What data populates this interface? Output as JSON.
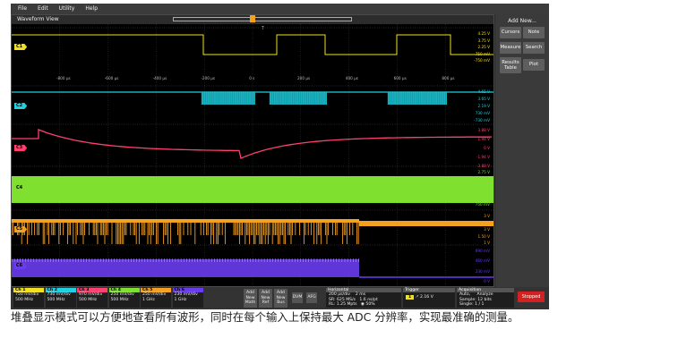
{
  "menu": [
    "File",
    "Edit",
    "Utility",
    "Help"
  ],
  "view_title": "Waveform View",
  "time_zero_marker": "T",
  "time_ticks": [
    "-800 µs",
    "-600 µs",
    "-400 µs",
    "-200 µs",
    "0 s",
    "200 µs",
    "400 µs",
    "600 µs",
    "800 µs"
  ],
  "channels": [
    {
      "label": "C1",
      "color": "#f0e020",
      "scale": [
        "4.25 V",
        "3.75 V",
        "2.25 V",
        "750 mV",
        "-750 mV"
      ]
    },
    {
      "label": "C2",
      "color": "#20d0e0",
      "scale": [
        "4.65 V",
        "3.65 V",
        "2.19 V",
        "730 mV",
        "-730 mV"
      ]
    },
    {
      "label": "C3",
      "color": "#ff4070",
      "scale": [
        "3.88 V",
        "1.94 V",
        "0 V",
        "-1.94 V",
        "-3.88 V"
      ]
    },
    {
      "label": "C4",
      "color": "#80e030",
      "scale": [
        "2.75 V",
        "2.25 V",
        "1.75 V",
        "1.25 V",
        "750 mV"
      ]
    },
    {
      "label": "C5",
      "color": "#f4a020",
      "scale": [
        "3 V",
        "450 V",
        "3 V",
        "1.50 V",
        "1 V"
      ]
    },
    {
      "label": "C6",
      "color": "#6a3cf0",
      "scale": [
        "690 mV",
        "460 mV",
        "230 mV",
        "0 V"
      ]
    }
  ],
  "right_panel": {
    "title": "Add New...",
    "buttons": [
      "Cursors",
      "Note",
      "Measure",
      "Search",
      "Results Table",
      "Plot"
    ]
  },
  "channel_badges": [
    {
      "name": "Ch 1",
      "color": "#f0e020",
      "vdiv": "750 mV/div",
      "bw": "500 MHz"
    },
    {
      "name": "Ch 2",
      "color": "#20d0e0",
      "vdiv": "730 mV/div",
      "bw": "500 MHz"
    },
    {
      "name": "Ch 3",
      "color": "#ff4070",
      "vdiv": "970 mV/div",
      "bw": "500 MHz"
    },
    {
      "name": "Ch 4",
      "color": "#80e030",
      "vdiv": "250 mV/div",
      "bw": "500 MHz"
    },
    {
      "name": "Ch 5",
      "color": "#f4a020",
      "vdiv": "250 mV/div",
      "bw": "1 GHz"
    },
    {
      "name": "Ch 6",
      "color": "#6a3cf0",
      "vdiv": "230 mV/div",
      "bw": "1 GHz"
    }
  ],
  "add_buttons": [
    {
      "line1": "Add",
      "line2": "New",
      "line3": "Math"
    },
    {
      "line1": "Add",
      "line2": "New",
      "line3": "Ref"
    },
    {
      "line1": "Add",
      "line2": "New",
      "line3": "Bus"
    }
  ],
  "dvm": "DVM",
  "afg": "AFG",
  "horizontal": {
    "title": "Horizontal",
    "line1a": "200 µs/div",
    "line1b": "2 ms",
    "line2a": "SR: 625 MS/s",
    "line2b": "1.6 ns/pt",
    "line3a": "RL: 1.25 Mpts",
    "line3b": "◉ 50%"
  },
  "trigger": {
    "title": "Trigger",
    "source": "1",
    "level": "2.16 V"
  },
  "acquisition": {
    "title": "Acquisition",
    "mode": "Auto,",
    "analyze": "Analyze",
    "sample": "Sample: 12 bits",
    "single": "Single: 1 / 1"
  },
  "run_state": "Stopped",
  "caption": "堆叠显示模式可以方便地查看所有波形，同时在每个输入上保持最大 ADC 分辨率，实现最准确的测量。"
}
